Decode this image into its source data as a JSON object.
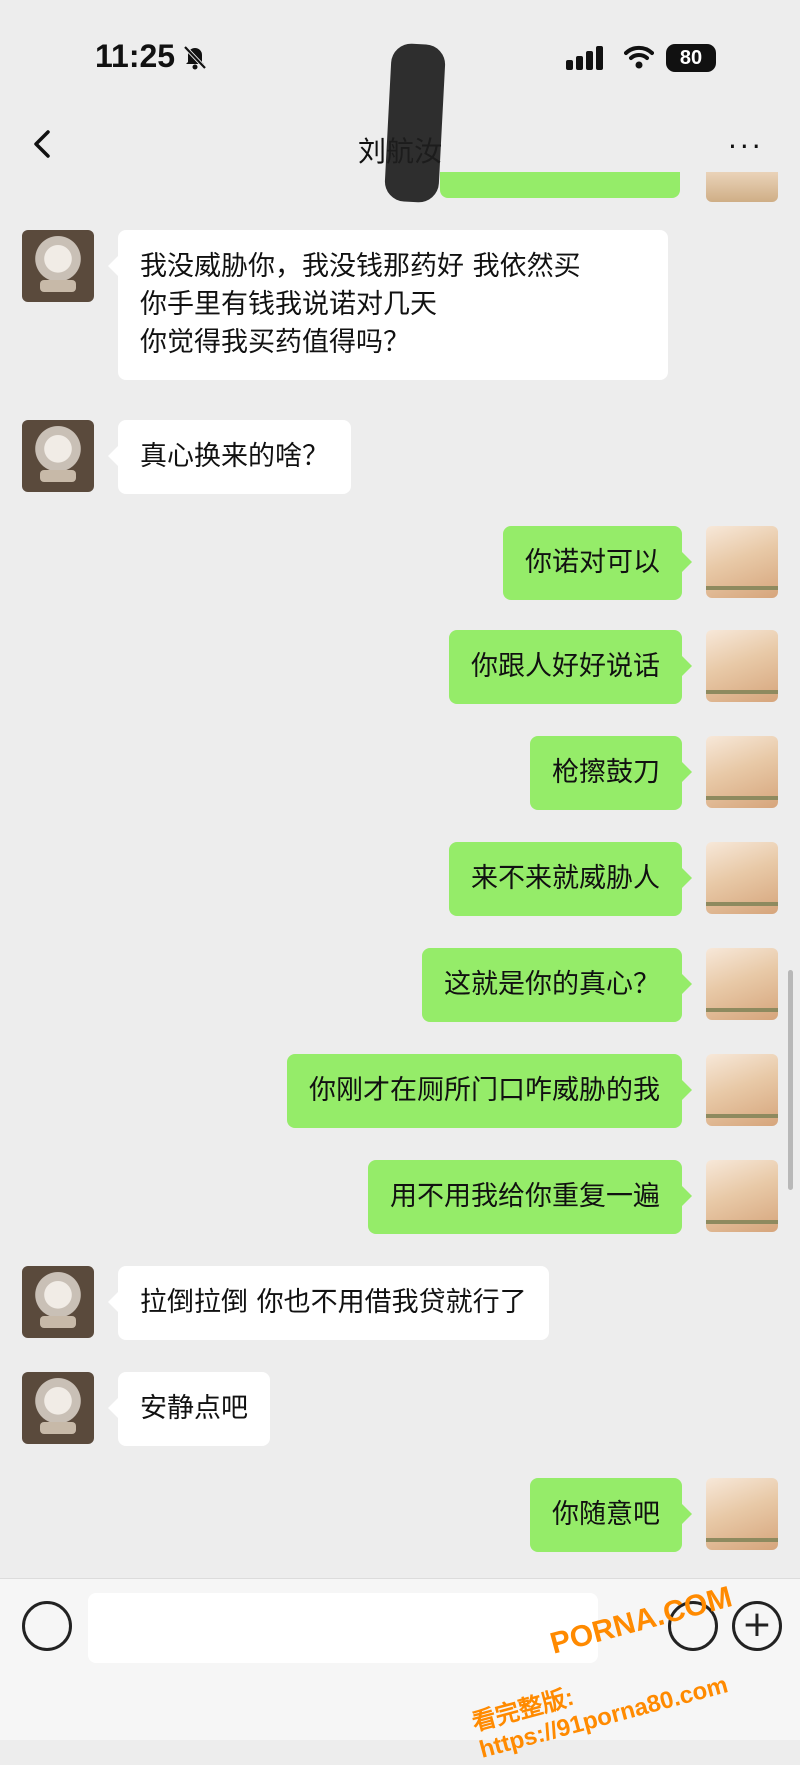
{
  "status_bar": {
    "time": "11:25",
    "battery": "80"
  },
  "nav": {
    "title": "刘航汝",
    "more": "···"
  },
  "messages": [
    {
      "side": "left",
      "text": "我没威胁你，我没钱那药好 我依然买\n你手里有钱我说诺对几天\n你觉得我买药值得吗？"
    },
    {
      "side": "left",
      "text": "真心换来的啥？"
    },
    {
      "side": "right",
      "text": "你诺对可以"
    },
    {
      "side": "right",
      "text": "你跟人好好说话"
    },
    {
      "side": "right",
      "text": "枪擦鼓刀"
    },
    {
      "side": "right",
      "text": "来不来就威胁人"
    },
    {
      "side": "right",
      "text": "这就是你的真心？"
    },
    {
      "side": "right",
      "text": "你刚才在厕所门口咋威胁的我"
    },
    {
      "side": "right",
      "text": "用不用我给你重复一遍"
    },
    {
      "side": "left",
      "text": "拉倒拉倒 你也不用借我贷就行了"
    },
    {
      "side": "left",
      "text": "安静点吧"
    },
    {
      "side": "right",
      "text": "你随意吧"
    }
  ],
  "watermark": {
    "site": "PORNA.COM",
    "line2": "看完整版: https://91porna80.com"
  },
  "colors": {
    "background": "#ededed",
    "sent_bubble": "#95ec69",
    "received_bubble": "#ffffff"
  }
}
